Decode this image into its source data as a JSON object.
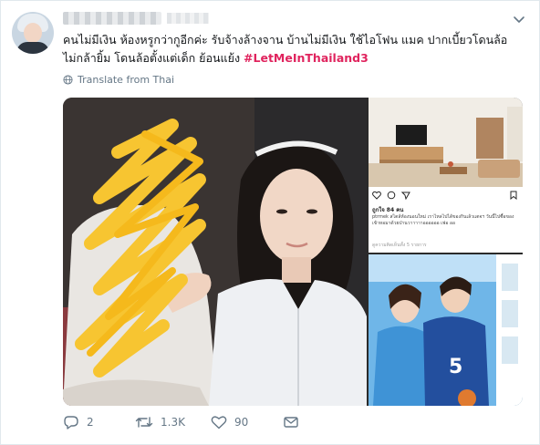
{
  "tweet": {
    "text_main": "คนไม่มีเงิน ห้องหรูกว่ากูอีกค่ะ  รับจ้างล้างจาน บ้านไม่มีเงิน ใช้ไอโฟน แมค  ปากเบี้ยวโดนล้อ ไม่กล้ายิ้ม โดนล้อตั้งแต่เด็ก  ย้อนแย้ง ",
    "hashtag": "#LetMeInThailand3",
    "translate_label": "Translate from Thai"
  },
  "media": {
    "instagram": {
      "likes": "ถูกใจ 84 คน",
      "caption": "ptrmek สไตล์ห้องนอนใหม่ เราไหลไปได้ของกินเล้วแตจฯ วันนี้ไปซื้อของเข้าหอมาด้วยป่านวาาาาาออออออ เฟอ ออ",
      "more": "ดูความคิดเห็นทั้ง 5 รายการ"
    }
  },
  "actions": {
    "reply_count": "2",
    "retweet_count": "1.3K",
    "like_count": "90"
  },
  "colors": {
    "hashtag": "#e0245e",
    "secondary_text": "#657786",
    "scribble": "#f7c531"
  },
  "icons": [
    "caret-down-icon",
    "globe-icon",
    "reply-icon",
    "retweet-icon",
    "like-icon",
    "direct-message-icon"
  ]
}
